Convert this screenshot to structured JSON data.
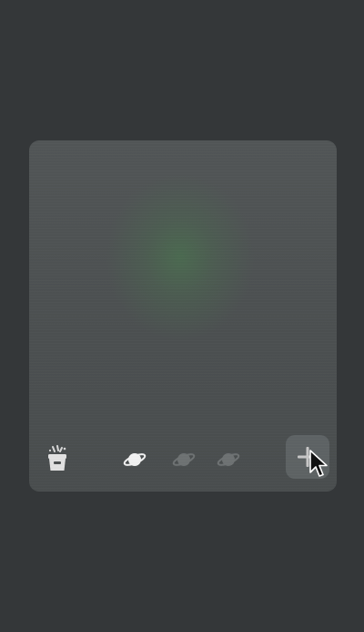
{
  "app": {
    "background_color": "#343739",
    "card_color": "#4f5354",
    "glow_color": "#4b6e50",
    "button_color": "#707576"
  },
  "toolbar": {
    "items": [
      {
        "name": "cleaner",
        "icon": "cleaner-basket-icon",
        "active": true
      },
      {
        "name": "planet-1",
        "icon": "planet-icon",
        "active": true
      },
      {
        "name": "planet-2",
        "icon": "planet-icon",
        "active": false
      },
      {
        "name": "planet-3",
        "icon": "planet-icon",
        "active": false
      }
    ],
    "add_button": {
      "icon": "plus-icon"
    }
  },
  "cursor": {
    "icon": "arrow-cursor-icon"
  }
}
